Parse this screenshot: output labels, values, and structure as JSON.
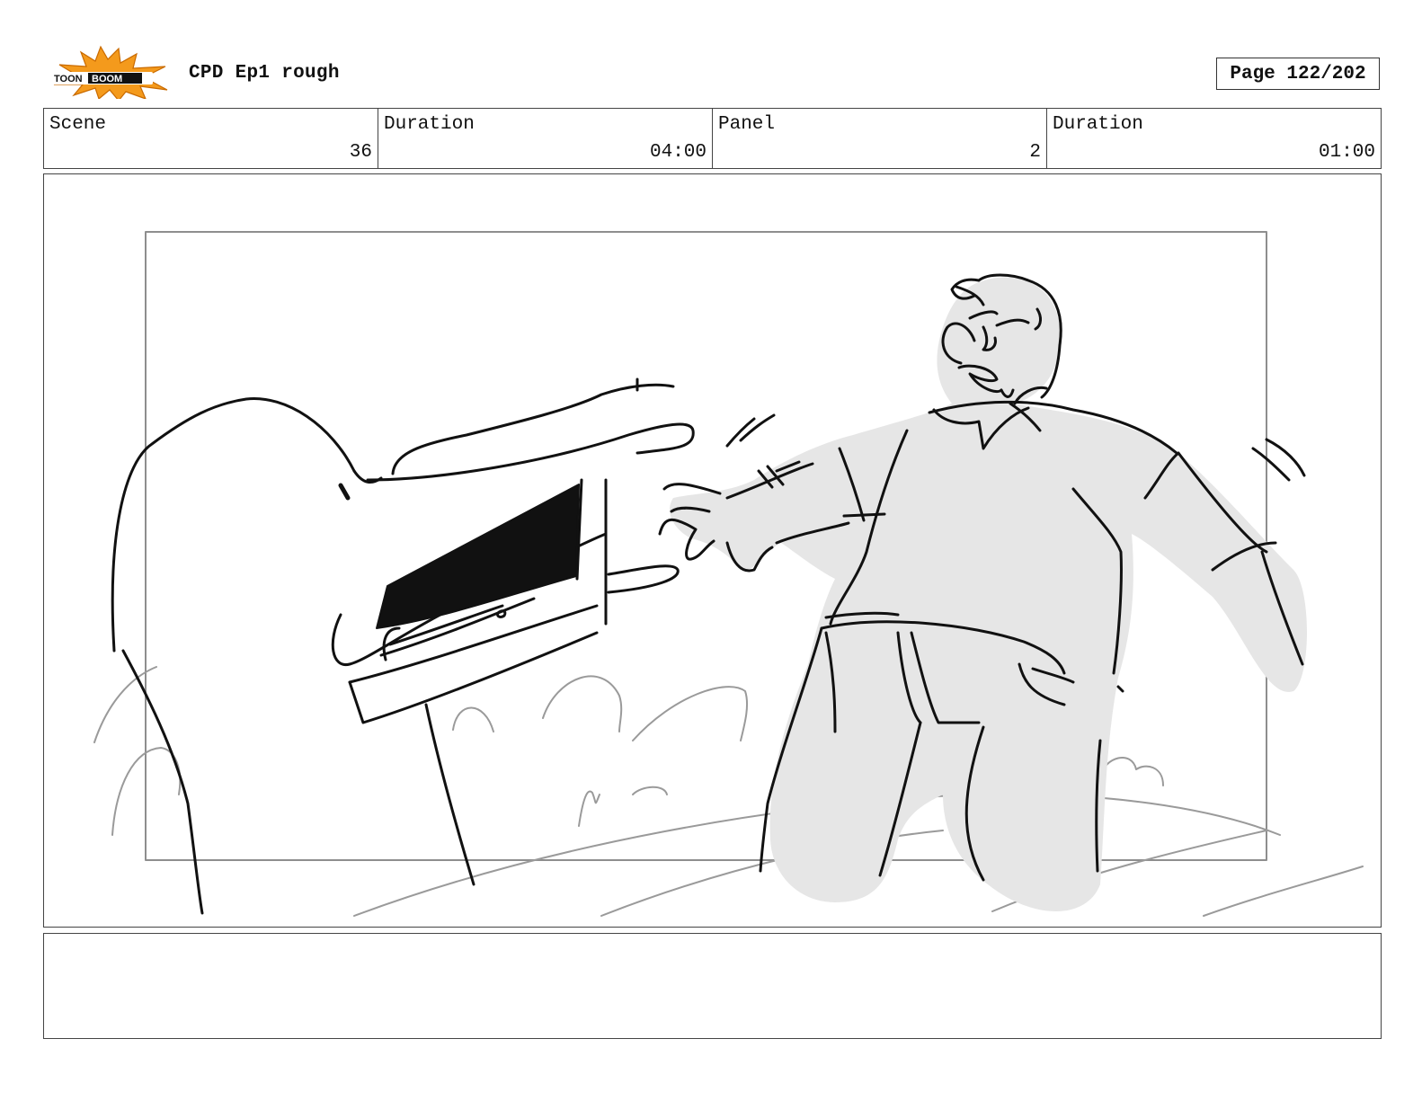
{
  "header": {
    "logo_text": "TOON BOOM",
    "title": "CPD Ep1 rough",
    "page": "Page 122/202"
  },
  "info": {
    "scene_label": "Scene",
    "scene_value": "36",
    "scene_duration_label": "Duration",
    "scene_duration_value": "04:00",
    "panel_label": "Panel",
    "panel_value": "2",
    "panel_duration_label": "Duration",
    "panel_duration_value": "01:00"
  },
  "notes": {
    "text": ""
  },
  "colors": {
    "logo_orange": "#f49a1c",
    "fill_gray": "#e6e6e6",
    "line": "#111111",
    "frame_gray": "#999999"
  }
}
